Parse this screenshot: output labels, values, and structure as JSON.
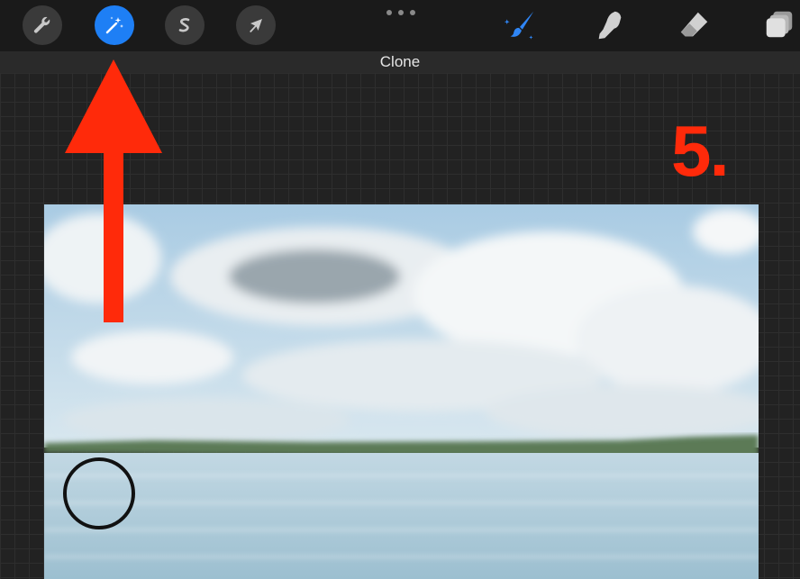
{
  "toolbar": {
    "left_tools": [
      {
        "name": "actions",
        "icon": "wrench-icon",
        "active": false
      },
      {
        "name": "adjustments",
        "icon": "magic-wand-icon",
        "active": true
      },
      {
        "name": "selection",
        "icon": "selection-s-icon",
        "active": false
      },
      {
        "name": "transform",
        "icon": "arrow-cursor-icon",
        "active": false
      }
    ],
    "more_icon": "more-dots-icon",
    "right_tools": [
      {
        "name": "paint",
        "icon": "paintbrush-icon",
        "active": true
      },
      {
        "name": "smudge",
        "icon": "smudge-finger-icon",
        "active": false
      },
      {
        "name": "erase",
        "icon": "eraser-icon",
        "active": false
      },
      {
        "name": "layers",
        "icon": "layers-icon",
        "active": false
      }
    ],
    "accent_color": "#1e7ff5"
  },
  "status": {
    "mode_label": "Clone"
  },
  "annotation": {
    "step_label": "5.",
    "color": "#ff2a0a",
    "arrow_icon": "up-arrow-icon"
  },
  "canvas": {
    "brush_cursor_icon": "clone-source-circle-icon"
  }
}
